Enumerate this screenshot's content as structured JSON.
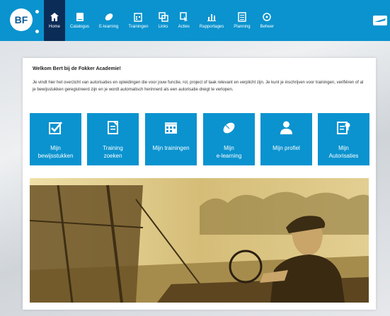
{
  "header": {
    "logo_text": "BF",
    "nav": [
      {
        "label": "Home",
        "icon": "home-icon",
        "active": true
      },
      {
        "label": "Catalogus",
        "icon": "book-icon"
      },
      {
        "label": "E-learning",
        "icon": "mouse-icon"
      },
      {
        "label": "Trainingen",
        "icon": "calendar-icon"
      },
      {
        "label": "Links",
        "icon": "links-icon"
      },
      {
        "label": "Acties",
        "icon": "cursor-icon"
      },
      {
        "label": "Rapportages",
        "icon": "bar-chart-icon"
      },
      {
        "label": "Planning",
        "icon": "planning-icon"
      },
      {
        "label": "Beheer",
        "icon": "settings-icon"
      }
    ],
    "accent": "#0a93cf",
    "active_color": "#0b2c57"
  },
  "main": {
    "welcome": "Welkom Bert bij de Fokker Academie!",
    "intro": "Je vindt hier het overzicht van autorisaties en opleidingen die voor jouw functie, rol, project of taak relevant en verplicht zijn. Je kunt je inschrijven voor trainingen, verifiëren of al je bewijsstukken geregistreerd zijn en je wordt automatisch herinnerd als een autorisatie dreigt te verlopen.",
    "tiles": [
      {
        "label": "Mijn\nbewijsstukken",
        "icon": "checkbox-icon"
      },
      {
        "label": "Training\nzoeken",
        "icon": "document-icon"
      },
      {
        "label": "Mijn trainingen",
        "icon": "calendar-icon"
      },
      {
        "label": "Mijn\ne-learning",
        "icon": "mouse-icon"
      },
      {
        "label": "Mijn profiel",
        "icon": "user-icon"
      },
      {
        "label": "Mijn\nAutorisaties",
        "icon": "certificate-icon"
      }
    ]
  }
}
